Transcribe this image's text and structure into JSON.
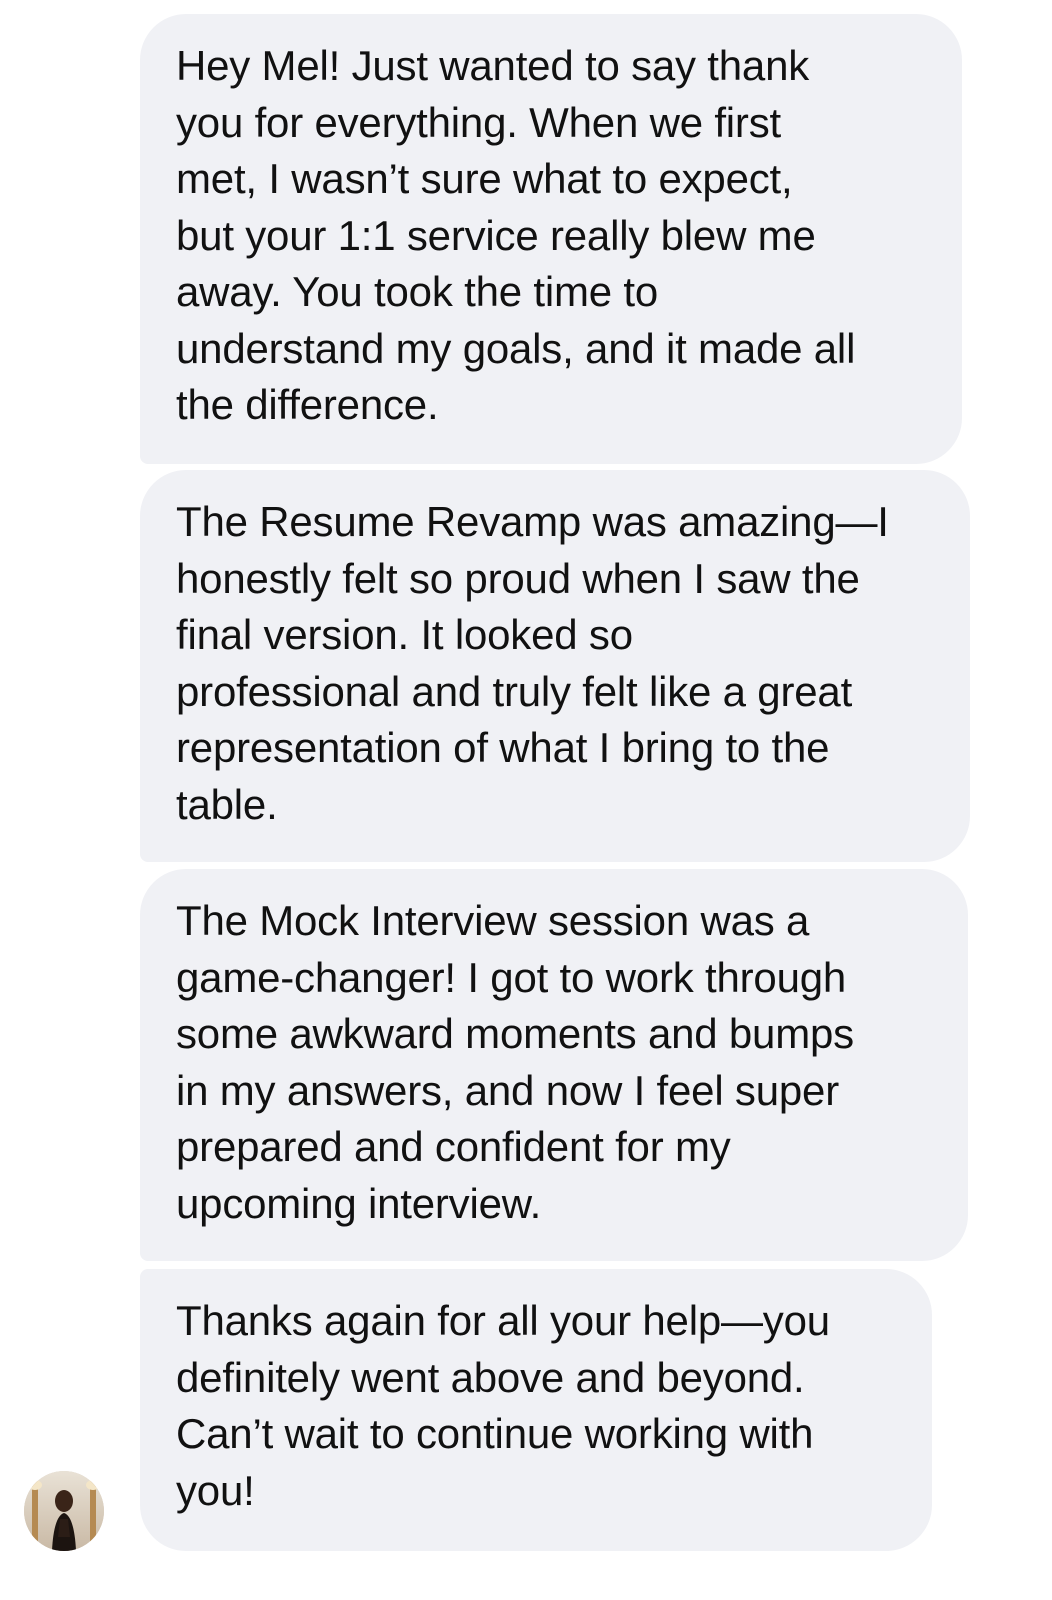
{
  "conversation": {
    "messages": [
      {
        "text": "Hey Mel! Just wanted to say thank\nyou for everything. When we first\nmet, I wasn’t sure what to expect,\nbut your 1:1 service really blew me\naway. You took the time to\nunderstand my goals, and it made all\nthe difference."
      },
      {
        "text": "The Resume Revamp was amazing—I\nhonestly felt so proud when I saw the\nfinal version. It looked so\nprofessional and truly felt like a great\nrepresentation of what I bring to the\ntable."
      },
      {
        "text": "The Mock Interview session was a\ngame-changer! I got to work through\nsome awkward moments and bumps\nin my answers, and now I feel super\nprepared and confident for my\nupcoming interview."
      },
      {
        "text": "Thanks again for all your help—you\ndefinitely went above and beyond.\nCan’t wait to continue working with\nyou!"
      }
    ],
    "sender_avatar": {
      "icon": "profile-photo-icon"
    }
  },
  "colors": {
    "bubble_background": "#f0f1f5",
    "text": "#111111",
    "page_background": "#ffffff"
  }
}
